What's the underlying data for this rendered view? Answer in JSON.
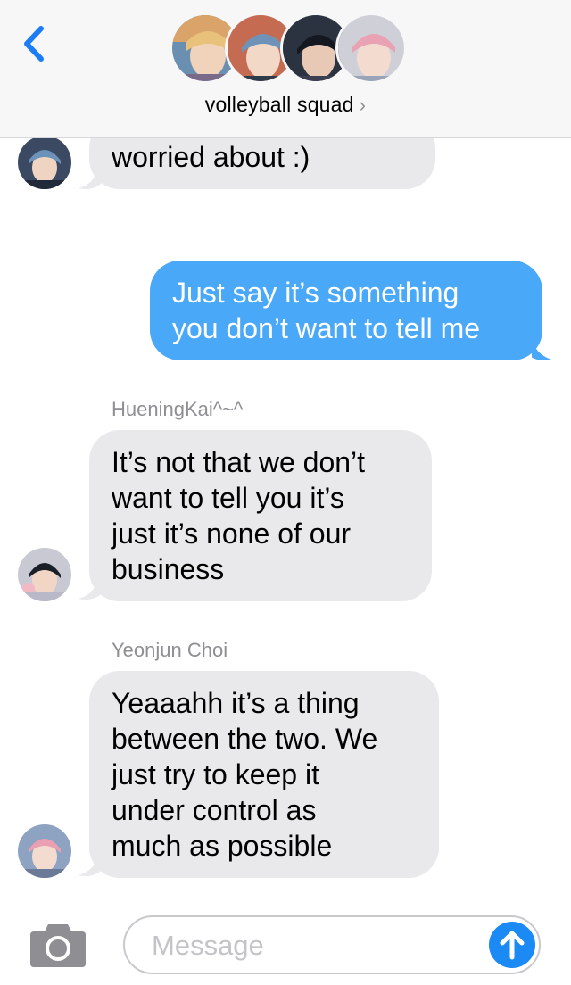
{
  "header": {
    "back_icon": "chevron-left-icon",
    "group_name": "volleyball squad",
    "group_chevron": "›",
    "accent_color": "#1b7cf5"
  },
  "messages": [
    {
      "direction": "incoming",
      "sender": "",
      "lines": [
        "worried about :)"
      ]
    },
    {
      "direction": "outgoing",
      "lines": [
        "Just say it’s something",
        "you don’t want to tell me"
      ]
    },
    {
      "direction": "incoming",
      "sender": "HueningKai^~^",
      "lines": [
        "It’s not that we don’t",
        "want to tell you it’s",
        "just it’s none of our",
        "business"
      ]
    },
    {
      "direction": "incoming",
      "sender": "Yeonjun Choi",
      "lines": [
        "Yeaaahh it’s a thing",
        "between the two. We",
        "just try to keep it",
        "under control as",
        "much as possible"
      ]
    }
  ],
  "composer": {
    "placeholder": "Message",
    "camera_icon": "camera-icon",
    "send_icon": "arrow-up-icon"
  },
  "colors": {
    "incoming_bubble": "#e9e9eb",
    "outgoing_bubble": "#4aa8f8",
    "send_button": "#1b8af5"
  }
}
